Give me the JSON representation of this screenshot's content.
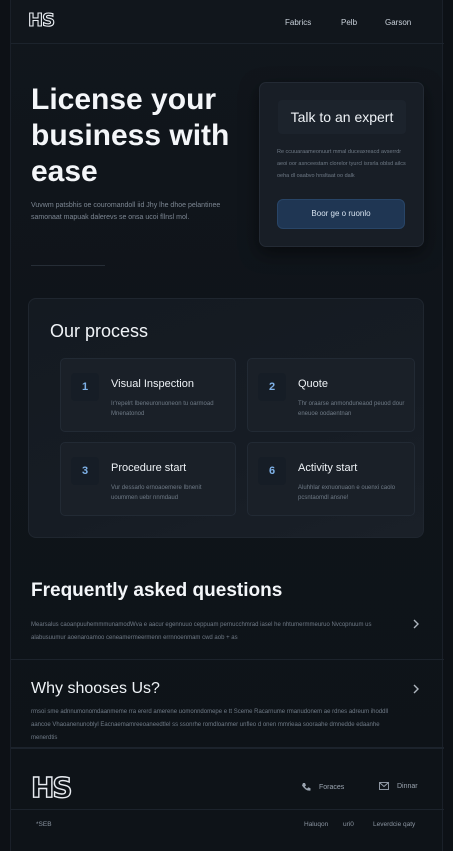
{
  "brand": {
    "logo_text": "HS"
  },
  "nav": {
    "items": [
      "Fabrics",
      "Pelb",
      "Garson"
    ]
  },
  "hero": {
    "title": "License your business with ease",
    "subtitle": "Vuvwm patsbhis oe couromandoll iid Jhy lhe dhoe pelantinee samonaat mapuak dalerevs se onsa ucoi fllnsl mol."
  },
  "expert": {
    "title": "Talk to an expert",
    "text": "Re ccuuaraameonuurt mmal duceaxreacd avserrdr aeoi oor asnceestam clorelor tyurcl isrsrla oblsd ailcs oeha dl oaabvo hnsltaat oo dalk",
    "button": "Boor ge o ruonlo"
  },
  "process": {
    "title": "Our process",
    "steps": [
      {
        "num": "1",
        "title": "Visual Inspection",
        "desc": "Ir'repelrt Ibeneuronuoneon tu oarmoad Mnenatonod"
      },
      {
        "num": "2",
        "title": "Quote",
        "desc": "Thr oraarse anmonduneaod peuod dour eneuoe oodaentnan"
      },
      {
        "num": "3",
        "title": "Procedure start",
        "desc": "Vur dessarlo ernoaoemere Ibnenit uoummen uebr nnmdaud"
      },
      {
        "num": "6",
        "title": "Activity start",
        "desc": "Aluhhlar exnuonuaon e ouenxi caolo pcsntaomdl ansne!"
      }
    ]
  },
  "faq": {
    "title": "Frequently asked questions",
    "items": [
      {
        "question": "",
        "answer": "Mearsalus caoanpuuhemmmunamodWva e aacur egennuuo ceppuam pernucchmrad iasel he nhtumermmeuruo Nvcopnuum us alabusuumur aoenaroamoo ceneamermeermenn errnnoenmam cwd aob + as"
      },
      {
        "question": "Why shooses Us?",
        "answer": "rmsoi sme adnnumonomdaanmeme rra ererd amerene uomonndomepe e tt Sceme Racarnume rmanudonem ae rdnes adreum ihoddll aancoe Vhaoanenunoblyl Eacnaemamreeoaneedtlel ss ssonrhe romdloanmer unfleo d onen mmrieaa sooraahe dmnedde edaanhe menerdtis"
      }
    ]
  },
  "footer": {
    "logo_text": "HS",
    "phone_label": "Foraces",
    "email_label": "Dinnar",
    "copyright": "*SEB",
    "links": [
      "Haluqon",
      "uri0",
      "Leverdcie qaty"
    ]
  },
  "colors": {
    "background": "#0d1116",
    "card": "#181e26",
    "accent_button": "#1f3653",
    "step_number": "#7fb2e8"
  }
}
